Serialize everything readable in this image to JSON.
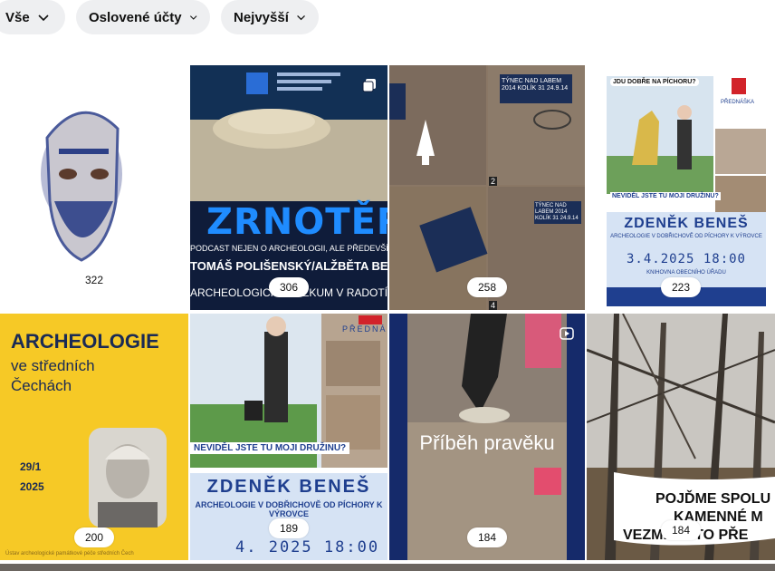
{
  "filters": [
    {
      "label": "Vše"
    },
    {
      "label": "Oslovené účty"
    },
    {
      "label": "Nejvyšší"
    }
  ],
  "tiles": [
    {
      "count": "322"
    },
    {
      "count": "306",
      "title": "ZRNOTĚRKA",
      "line1": "PODCAST NEJEN O ARCHEOLOGII, ALE PŘEDEVŠÍM O NÍ.",
      "line2": "TOMÁŠ POLIŠENSKÝ/ALŽBĚTA BERGEROVÁ",
      "line3": "ARCHEOLOGICKÝ VÝZKUM V RADOTÍNĚ"
    },
    {
      "count": "258",
      "label_a": "TÝNEC NAD LABEM 2014 KOLÍK 31 24.9.14",
      "label_b": "TÝNEC NAD LABEM 2014 KOLÍK 31 24.9.14",
      "n2": "2",
      "n4": "4"
    },
    {
      "count": "223",
      "bubble": "JDU DOBŘE NA PÍCHORU?",
      "question": "NEVIDĚL JSTE TU MOJI DRUŽINU?",
      "name": "ZDENĚK BENEŠ",
      "sub": "ARCHEOLOGIE V DOBŘICHOVĚ OD PÍCHORY K VÝROVCE",
      "date": "3.4.2025 18:00",
      "place": "KNIHOVNA OBECNÍHO ÚŘADU",
      "label": "PŘEDNÁŠKA"
    },
    {
      "count": "200",
      "title": "ARCHEOLOGIE",
      "sub1": "ve středních",
      "sub2": "Čechách",
      "d1": "29/1",
      "d2": "2025",
      "footer": "Ústav archeologické památkové péče středních Čech"
    },
    {
      "count": "189",
      "question": "NEVIDĚL JSTE TU MOJI DRUŽINU?",
      "name": "ZDENĚK BENEŠ",
      "sub": "ARCHEOLOGIE V DOBŘICHOVĚ OD PÍCHORY K VÝROVCE",
      "date": "4. 2025 18:00",
      "label": "PŘEDNÁŠKA"
    },
    {
      "count": "184",
      "title": "Příběh pravěku"
    },
    {
      "count": "184",
      "caption1": "POJĎME SPOLU",
      "caption2": "KAMENNÉ M",
      "caption3": "VEZMI SE TO PŘE"
    }
  ],
  "colors": {
    "chip_bg": "#eeeff1",
    "yellow": "#f6c926",
    "blue_band": "#1f3f8f"
  }
}
